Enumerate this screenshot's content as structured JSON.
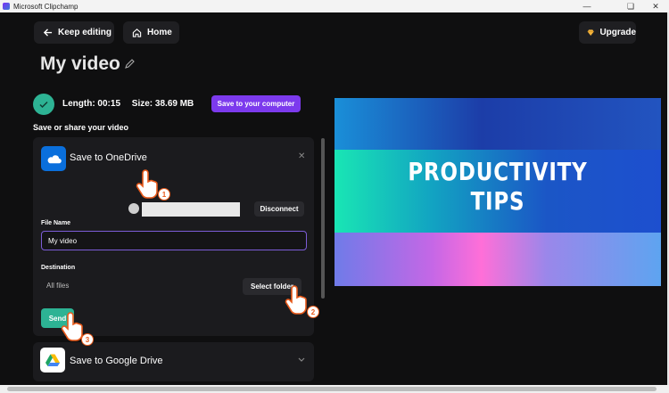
{
  "window": {
    "title": "Microsoft Clipchamp",
    "controls": [
      "minimize-icon",
      "restore-icon",
      "close-icon"
    ]
  },
  "toolbar": {
    "keep_editing": "Keep editing",
    "home": "Home",
    "upgrade": "Upgrade"
  },
  "project": {
    "title": "My video"
  },
  "export": {
    "length": "Length: 00:15",
    "size": "Size: 38.69 MB",
    "save_computer": "Save to your computer",
    "section_label": "Save or share your video"
  },
  "onedrive": {
    "title": "Save to OneDrive",
    "disconnect": "Disconnect",
    "file_name_label": "File Name",
    "file_name_value": "My video",
    "destination_label": "Destination",
    "destination_value": "All files",
    "select_folder": "Select folder",
    "send": "Send"
  },
  "google_drive": {
    "title": "Save to Google Drive"
  },
  "preview": {
    "line1": "PRODUCTIVITY",
    "line2": "TIPS"
  },
  "steps": [
    "1",
    "2",
    "3"
  ],
  "colors": {
    "accent_purple": "#7c3aed",
    "accent_green": "#2db394",
    "onedrive_blue": "#0a6fdc",
    "step_badge": "#e85a1b"
  }
}
